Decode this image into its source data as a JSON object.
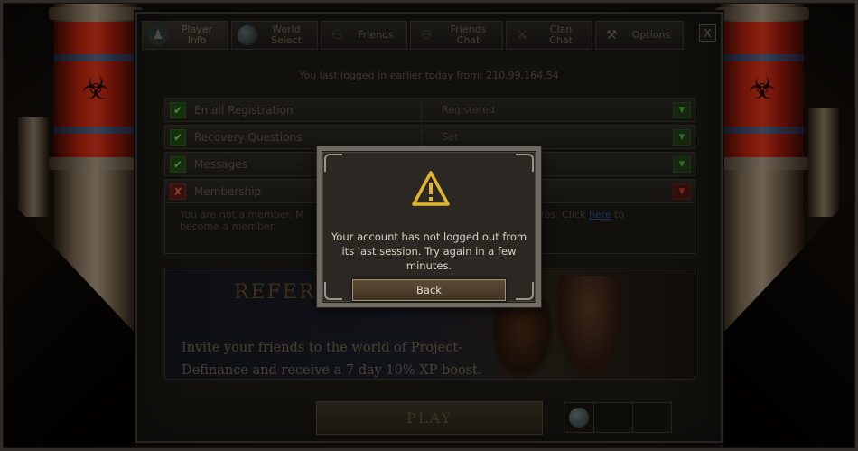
{
  "tabs": [
    {
      "label": "Player\nInfo",
      "icon": "player-icon",
      "active": true
    },
    {
      "label": "World\nSelect",
      "icon": "globe-icon",
      "active": false
    },
    {
      "label": "Friends",
      "icon": "friends-icon",
      "active": false
    },
    {
      "label": "Friends\nChat",
      "icon": "friends-chat-icon",
      "active": false
    },
    {
      "label": "Clan\nChat",
      "icon": "clan-chat-icon",
      "active": false
    },
    {
      "label": "Options",
      "icon": "tools-icon",
      "active": false
    }
  ],
  "close_label": "X",
  "last_login": "You last logged in earlier today from: 210.99.164.54",
  "status_rows": [
    {
      "name": "Email Registration",
      "value": "Registered",
      "ok": true
    },
    {
      "name": "Recovery Questions",
      "value": "Set",
      "ok": true
    },
    {
      "name": "Messages",
      "value": "",
      "ok": true
    },
    {
      "name": "Membership",
      "value": "",
      "ok": false
    }
  ],
  "membership_info": {
    "text_start": "You are not a member. M",
    "text_end": "atures. Click ",
    "link": "here",
    "text_after_link": " to",
    "text_line2": "become a member."
  },
  "banner": {
    "heading": "REFER",
    "line1": "Invite your friends to the world of Project-",
    "line2": "Definance and receive a 7 day 10% XP boost."
  },
  "play_label": "PLAY",
  "dialog": {
    "line1": "Your account has not logged out from",
    "line2": "its last session. Try again in a few",
    "line3": "minutes.",
    "back_label": "Back"
  },
  "colors": {
    "accent_red": "#c42a14",
    "ok_green": "#2c5d22",
    "dialog_text": "#d9d4c8"
  }
}
